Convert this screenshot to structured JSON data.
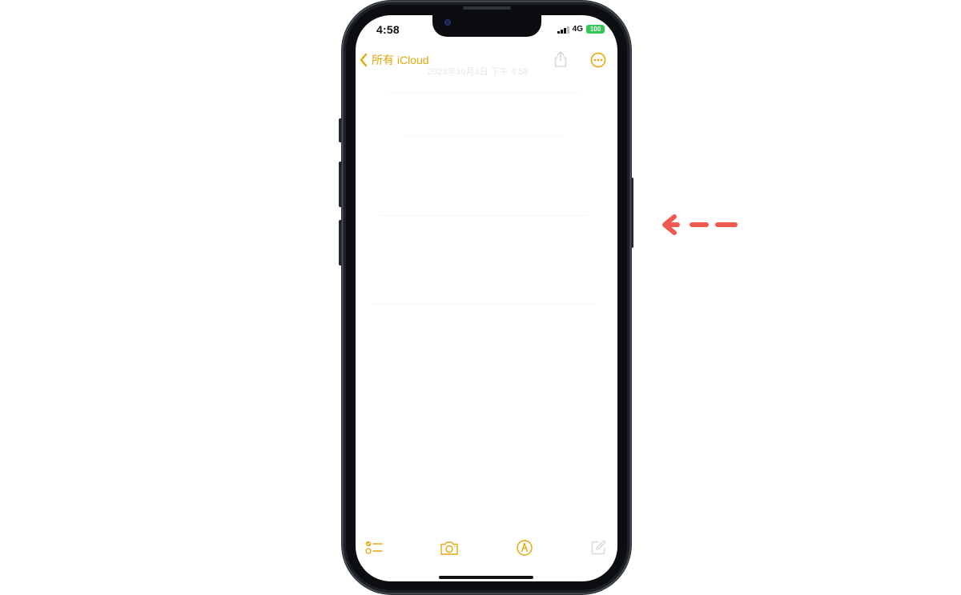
{
  "status_bar": {
    "time": "4:58",
    "network": "4G",
    "battery": "100"
  },
  "nav": {
    "back_label": "所有 iCloud",
    "date_text": "2023年10月3日 下午 4:58",
    "share_icon": "share-icon",
    "more_icon": "ellipsis-circle-icon"
  },
  "toolbar": {
    "checklist_icon": "checklist-icon",
    "camera_icon": "camera-icon",
    "markup_icon": "markup-pen-icon",
    "compose_icon": "compose-icon"
  },
  "colors": {
    "accent": "#e6a70a",
    "battery": "#34c759",
    "annotation_arrow": "#f05a4e",
    "phone_frame": "#1d2126"
  }
}
